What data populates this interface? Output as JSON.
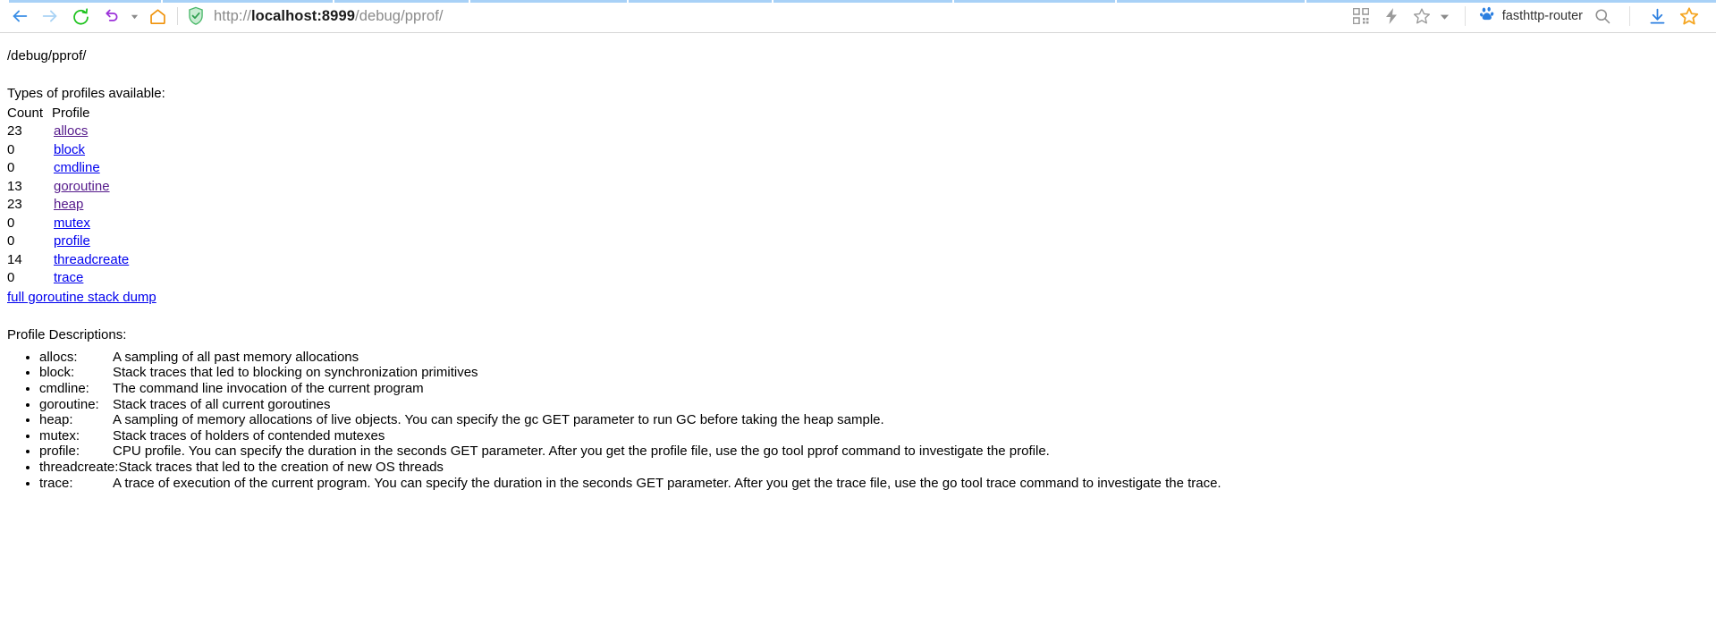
{
  "browser": {
    "nav": {
      "back_icon": "arrow-left-icon",
      "forward_icon": "arrow-right-icon",
      "reload_icon": "reload-icon",
      "history_icon": "undo-icon",
      "history_dropdown_icon": "chevron-down-icon",
      "home_icon": "home-icon"
    },
    "omnibox": {
      "security_icon": "shield-check-icon",
      "url_scheme": "http://",
      "url_host": "localhost:8999",
      "url_path": "/debug/pprof/",
      "full_url": "http://localhost:8999/debug/pprof/",
      "actions": [
        {
          "name": "qr-code-icon",
          "label": "QR code"
        },
        {
          "name": "lightning-icon",
          "label": "Quick actions"
        },
        {
          "name": "star-outline-icon",
          "label": "Bookmark"
        },
        {
          "name": "chevron-down-icon",
          "label": "More"
        }
      ]
    },
    "bookmark": {
      "favicon": "baidu-paw-icon",
      "label": "fasthttp-router"
    },
    "right_actions": [
      {
        "name": "search-icon",
        "label": "Search"
      },
      {
        "name": "download-icon",
        "label": "Downloads"
      },
      {
        "name": "star-filled-icon",
        "label": "Favorites"
      }
    ]
  },
  "page": {
    "heading": "/debug/pprof/",
    "profiles_intro": "Types of profiles available:",
    "table": {
      "columns": [
        "Count",
        "Profile"
      ],
      "rows": [
        {
          "count": "23",
          "profile": "allocs",
          "visited": true
        },
        {
          "count": "0",
          "profile": "block",
          "visited": false
        },
        {
          "count": "0",
          "profile": "cmdline",
          "visited": false
        },
        {
          "count": "13",
          "profile": "goroutine",
          "visited": true
        },
        {
          "count": "23",
          "profile": "heap",
          "visited": true
        },
        {
          "count": "0",
          "profile": "mutex",
          "visited": false
        },
        {
          "count": "0",
          "profile": "profile",
          "visited": false
        },
        {
          "count": "14",
          "profile": "threadcreate",
          "visited": false
        },
        {
          "count": "0",
          "profile": "trace",
          "visited": false
        }
      ]
    },
    "stack_dump_link": "full goroutine stack dump",
    "descriptions_heading": "Profile Descriptions:",
    "descriptions": [
      {
        "name": "allocs:",
        "text": "A sampling of all past memory allocations"
      },
      {
        "name": "block:",
        "text": "Stack traces that led to blocking on synchronization primitives"
      },
      {
        "name": "cmdline:",
        "text": "The command line invocation of the current program"
      },
      {
        "name": "goroutine:",
        "text": "Stack traces of all current goroutines"
      },
      {
        "name": "heap:",
        "text": "A sampling of memory allocations of live objects. You can specify the gc GET parameter to run GC before taking the heap sample."
      },
      {
        "name": "mutex:",
        "text": "Stack traces of holders of contended mutexes"
      },
      {
        "name": "profile:",
        "text": "CPU profile. You can specify the duration in the seconds GET parameter. After you get the profile file, use the go tool pprof command to investigate the profile."
      },
      {
        "name": "threadcreate:",
        "text": "Stack traces that led to the creation of new OS threads"
      },
      {
        "name": "trace:",
        "text": "A trace of execution of the current program. You can specify the duration in the seconds GET parameter. After you get the trace file, use the go tool trace command to investigate the trace."
      }
    ]
  },
  "colors": {
    "link": "#0000ee",
    "link_visited": "#551a8b",
    "accent_blue": "#4a90e2",
    "star_orange": "#f5a623",
    "reload_green": "#22b14c",
    "history_purple": "#8e44d8",
    "home_orange": "#f0920a"
  }
}
